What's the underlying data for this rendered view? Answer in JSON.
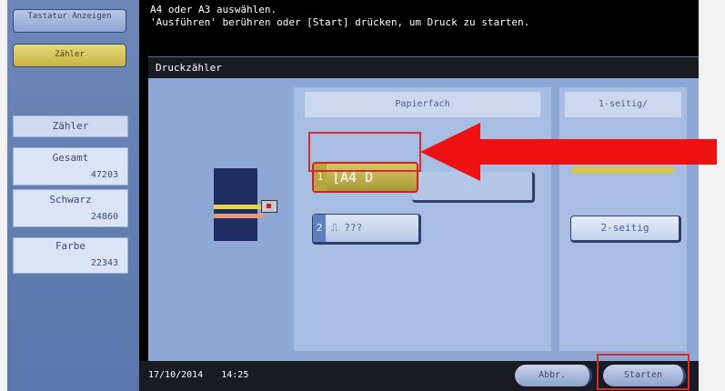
{
  "sidebar": {
    "top_buttons": [
      {
        "label": "Tastatur Anzeigen"
      },
      {
        "label": "Zähler",
        "active": true
      }
    ],
    "counter_title": "Zähler",
    "counters": [
      {
        "label": "Gesamt",
        "value": "47203"
      },
      {
        "label": "Schwarz",
        "value": "24860"
      },
      {
        "label": "Farbe",
        "value": "22343"
      }
    ]
  },
  "message": {
    "line1": "A4 oder A3 auswählen.",
    "line2": "'Ausführen' berühren oder [Start] drücken, um Druck zu starten."
  },
  "panel": {
    "title": "Druckzähler",
    "paper_column": {
      "heading": "Papierfach",
      "trays": [
        {
          "number": "1",
          "label": "⌊A4 D",
          "selected": true
        },
        {
          "number": "2",
          "label": "⎍ ???",
          "selected": false
        }
      ]
    },
    "side_column": {
      "heading": "1-seitig/",
      "duplex_label": "2-seitig"
    }
  },
  "bottombar": {
    "date": "17/10/2014",
    "time": "14:25",
    "cancel_label": "Abbr.",
    "start_label": "Starten"
  },
  "colors": {
    "highlight_red": "#d42c2c",
    "selected_gold": "#c8b445",
    "panel_blue": "#8ea8d6"
  }
}
